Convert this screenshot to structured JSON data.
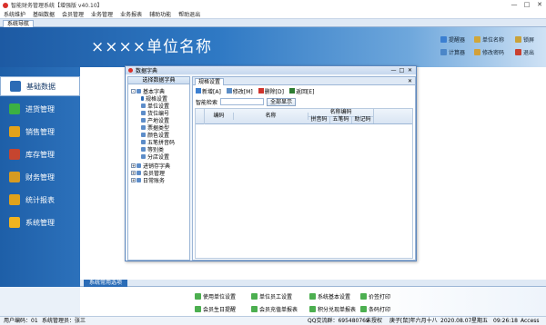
{
  "app": {
    "title": "智能财务管理系统【增强版 v40.10】"
  },
  "menu": [
    "系统维护",
    "基础数据",
    "会员管理",
    "业务管理",
    "业务报表",
    "辅助功能",
    "帮助退出"
  ],
  "window_tab": "系统导航",
  "header": {
    "unit_name": "××××单位名称",
    "buttons": [
      {
        "label": "提醒器",
        "icon": "bell-icon",
        "color": "#3b7fd1"
      },
      {
        "label": "单位名称",
        "icon": "building-icon",
        "color": "#d0a63a"
      },
      {
        "label": "锁屏",
        "icon": "lock-icon",
        "color": "#c9a23a"
      },
      {
        "label": "计算器",
        "icon": "calculator-icon",
        "color": "#4b86c8"
      },
      {
        "label": "修改密码",
        "icon": "key-icon",
        "color": "#d2a03a"
      },
      {
        "label": "退出",
        "icon": "exit-icon",
        "color": "#c94030"
      }
    ]
  },
  "sidebar": [
    {
      "label": "基础数据",
      "icon": "pencil-icon",
      "color": "#2c6bb5",
      "active": true
    },
    {
      "label": "进货管理",
      "icon": "plus-icon",
      "color": "#3cb043"
    },
    {
      "label": "销售管理",
      "icon": "cube-icon",
      "color": "#e3a21a"
    },
    {
      "label": "库存管理",
      "icon": "house-icon",
      "color": "#c6452f"
    },
    {
      "label": "财务管理",
      "icon": "coins-icon",
      "color": "#d69b22"
    },
    {
      "label": "统计报表",
      "icon": "bar-chart-icon",
      "color": "#e0a21b"
    },
    {
      "label": "系统管理",
      "icon": "gear-icon",
      "color": "#f1b420"
    }
  ],
  "dialog": {
    "title": "数据字典",
    "tree_header": "选择数据字典",
    "tree": [
      {
        "label": "基本字典",
        "level": 0,
        "toggle": "-"
      },
      {
        "label": "规格设置",
        "level": 1
      },
      {
        "label": "单位设置",
        "level": 1
      },
      {
        "label": "货位编号",
        "level": 1
      },
      {
        "label": "产地设置",
        "level": 1
      },
      {
        "label": "票据类型",
        "level": 1
      },
      {
        "label": "颜色设置",
        "level": 1
      },
      {
        "label": "五笔拼音码",
        "level": 1
      },
      {
        "label": "等别类",
        "level": 1
      },
      {
        "label": "分店设置",
        "level": 1
      },
      {
        "label": "进销存字典",
        "level": 0,
        "toggle": "+"
      },
      {
        "label": "会员管理",
        "level": 0,
        "toggle": "+"
      },
      {
        "label": "日常账务",
        "level": 0,
        "toggle": "+"
      }
    ],
    "panel_tab": "规格设置",
    "toolbar": [
      {
        "label": "新增[A]",
        "icon": "add-icon",
        "color": "#3b7fd1"
      },
      {
        "label": "修改[M]",
        "icon": "edit-icon",
        "color": "#5b8dc6"
      },
      {
        "label": "删除[D]",
        "icon": "delete-icon",
        "color": "#d0342c"
      },
      {
        "label": "返回[E]",
        "icon": "return-icon",
        "color": "#2e7d32"
      }
    ],
    "search_label": "智能检索",
    "search_value": "",
    "show_all": "全部显示",
    "grid": {
      "col_code": "编码",
      "col_name": "名称",
      "col_group": "名称编码",
      "col_pinyin": "拼音码",
      "col_wubi": "五笔码",
      "col_custom": "助记码"
    }
  },
  "bottom": {
    "tab": "系统常用选项",
    "quick": [
      "使用单位设置",
      "单位员工设置",
      "系统基本设置",
      "价签打印",
      "会员生日提醒",
      "会员充值单报表",
      "积分兑现单报表",
      "条码打印"
    ]
  },
  "status": {
    "user": "用户编码：01",
    "manager": "系统管理员：张三",
    "qq": "QQ交流群：695480769",
    "auth": "未授权",
    "date_text": "庚子[鼠]年六月十八",
    "date": "2020.08.07",
    "weekday": "星期五",
    "time": "09:26:18",
    "db": "Access"
  }
}
